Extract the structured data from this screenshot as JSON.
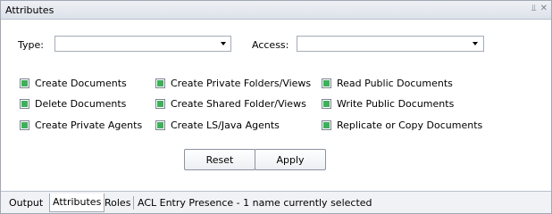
{
  "panel": {
    "title": "Attributes",
    "pin_icon": "pin-icon",
    "close_icon": "close-icon"
  },
  "fields": {
    "type_label": "Type:",
    "type_value": "",
    "access_label": "Access:",
    "access_value": ""
  },
  "checkboxes": [
    {
      "label": "Create Documents",
      "checked": true
    },
    {
      "label": "Delete Documents",
      "checked": true
    },
    {
      "label": "Create Private Agents",
      "checked": true
    },
    {
      "label": "Create Private Folders/Views",
      "checked": true
    },
    {
      "label": "Create Shared Folder/Views",
      "checked": true
    },
    {
      "label": "Create LS/Java Agents",
      "checked": true
    },
    {
      "label": "Read Public Documents",
      "checked": true
    },
    {
      "label": "Write Public Documents",
      "checked": true
    },
    {
      "label": "Replicate or Copy Documents",
      "checked": true
    }
  ],
  "buttons": {
    "reset": "Reset",
    "apply": "Apply"
  },
  "tabs": [
    {
      "label": "Output",
      "active": false
    },
    {
      "label": "Attributes",
      "active": true
    },
    {
      "label": "Roles",
      "active": false
    },
    {
      "label": "ACL Entry Presence - 1 name currently selected",
      "active": false
    }
  ],
  "colors": {
    "checkbox_fill": "#3db05a",
    "title_bg": "#dde2ea"
  }
}
